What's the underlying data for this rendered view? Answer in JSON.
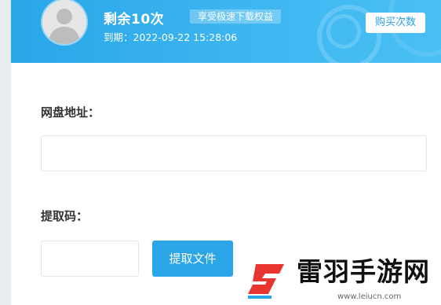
{
  "header": {
    "remaining": "剩余10次",
    "badge": "享受极速下载权益",
    "expiry": "到期：2022-09-22 15:28:06",
    "buy_button": "购买次数",
    "bg_color": "#2aa6e8"
  },
  "form": {
    "url_label": "网盘地址：",
    "url_value": "",
    "code_label": "提取码：",
    "code_value": "",
    "extract_button": "提取文件"
  },
  "watermark": {
    "title": "雷羽手游网",
    "url": "www.leiucn.com",
    "accent": "#e8352f"
  }
}
